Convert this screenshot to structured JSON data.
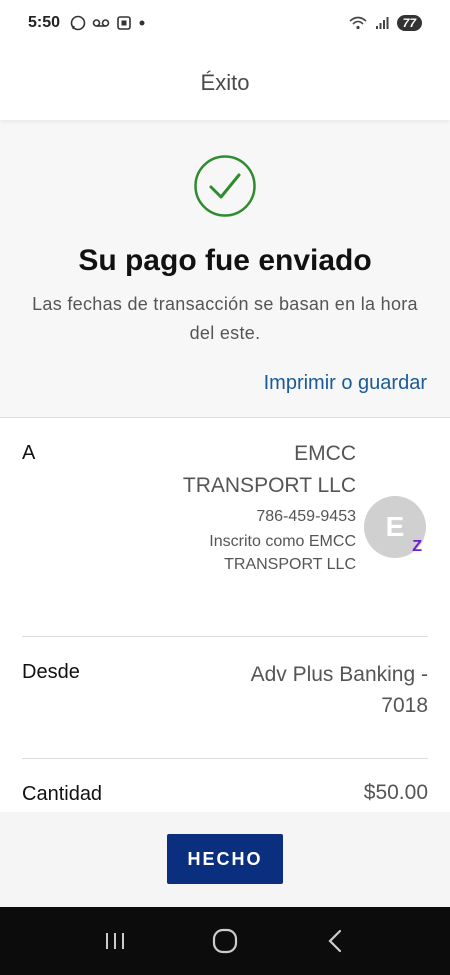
{
  "status_bar": {
    "time": "5:50",
    "battery": "77",
    "icons_left": [
      "whatsapp-icon",
      "voicemail-icon",
      "screenshot-icon",
      "dot-icon"
    ],
    "icons_right": [
      "wifi-icon",
      "signal-icon",
      "battery-icon"
    ]
  },
  "header": {
    "title": "Éxito"
  },
  "success": {
    "title": "Su pago fue enviado",
    "subtitle": "Las fechas de transacción se basan en la hora del este.",
    "print_link": "Imprimir o guardar",
    "icon": "check-circle-icon",
    "check_color": "#2e8b2e"
  },
  "details": {
    "to": {
      "label": "A",
      "name": "EMCC TRANSPORT LLC",
      "phone": "786-459-9453",
      "enrolled": "Inscrito como EMCC TRANSPORT LLC",
      "avatar_initial": "E",
      "badge": "Z"
    },
    "from": {
      "label": "Desde",
      "value": "Adv Plus Banking - 7018"
    },
    "amount": {
      "label": "Cantidad",
      "value": "$50.00"
    }
  },
  "actions": {
    "done_label": "HECHO"
  },
  "nav": {
    "buttons": [
      "recents-icon",
      "home-icon",
      "back-icon"
    ]
  },
  "colors": {
    "accent_link": "#1a5a96",
    "primary_button": "#0b2f7f",
    "zelle": "#6d1ed4"
  }
}
